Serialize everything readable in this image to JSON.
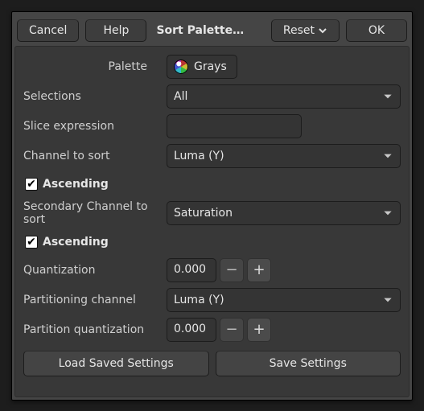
{
  "header": {
    "cancel": "Cancel",
    "help": "Help",
    "title": "Sort Palette…",
    "reset": "Reset",
    "ok": "OK"
  },
  "labels": {
    "palette": "Palette",
    "selections": "Selections",
    "slice_expression": "Slice expression",
    "channel_to_sort": "Channel to sort",
    "ascending1": "Ascending",
    "secondary_channel": "Secondary Channel to sort",
    "ascending2": "Ascending",
    "quantization": "Quantization",
    "partitioning_channel": "Partitioning channel",
    "partition_quantization": "Partition quantization"
  },
  "values": {
    "palette_name": "Grays",
    "selections": "All",
    "slice_expression": "",
    "channel_to_sort": "Luma (Y)",
    "ascending1": true,
    "secondary_channel": "Saturation",
    "ascending2": true,
    "quantization": "0.000",
    "partitioning_channel": "Luma (Y)",
    "partition_quantization": "0.000"
  },
  "footer": {
    "load": "Load Saved Settings",
    "save": "Save Settings"
  }
}
